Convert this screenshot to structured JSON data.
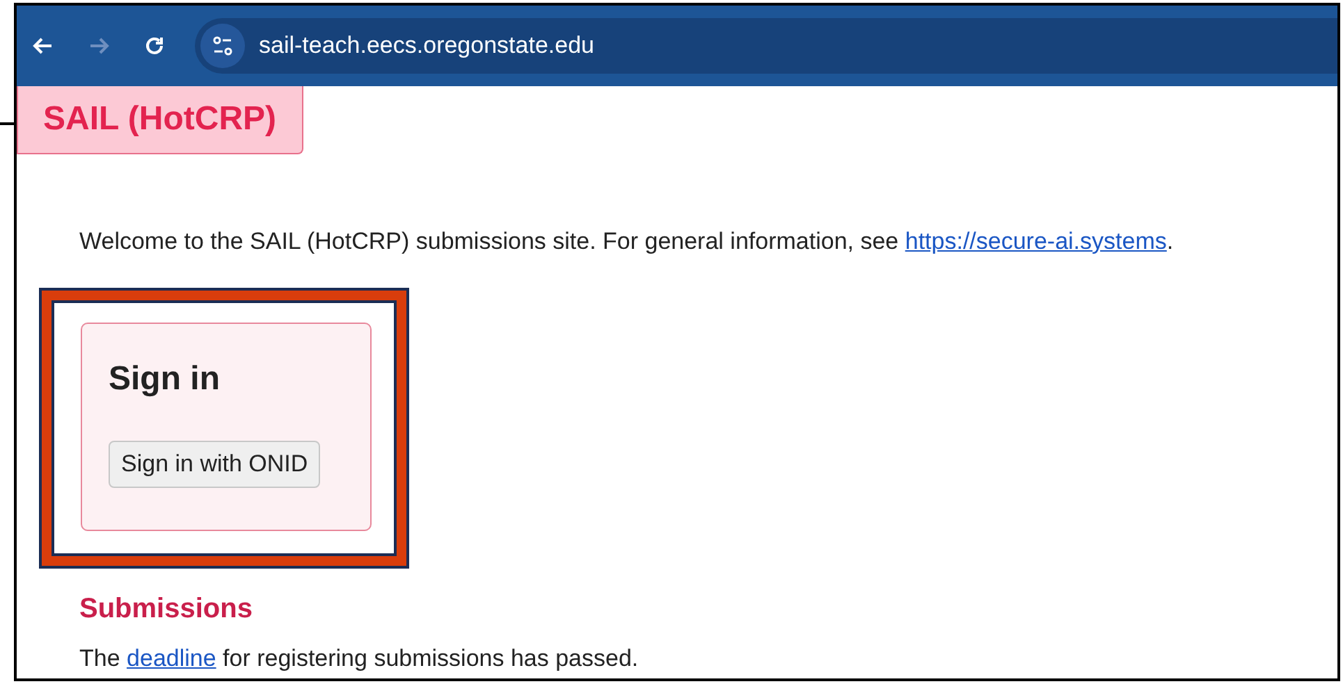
{
  "browser": {
    "url": "sail-teach.eecs.oregonstate.edu",
    "forward_disabled": true
  },
  "site_title": "SAIL (HotCRP)",
  "welcome": {
    "text": "Welcome to the SAIL (HotCRP) submissions site. For general information, see ",
    "link": "https://secure-ai.systems",
    "end": "."
  },
  "sign_in": {
    "title": "Sign in",
    "button": "Sign in with ONID",
    "highlighted": true
  },
  "submissions": {
    "heading": "Submissions",
    "before": "The ",
    "link": "deadline",
    "after": " for registering submissions has passed."
  }
}
